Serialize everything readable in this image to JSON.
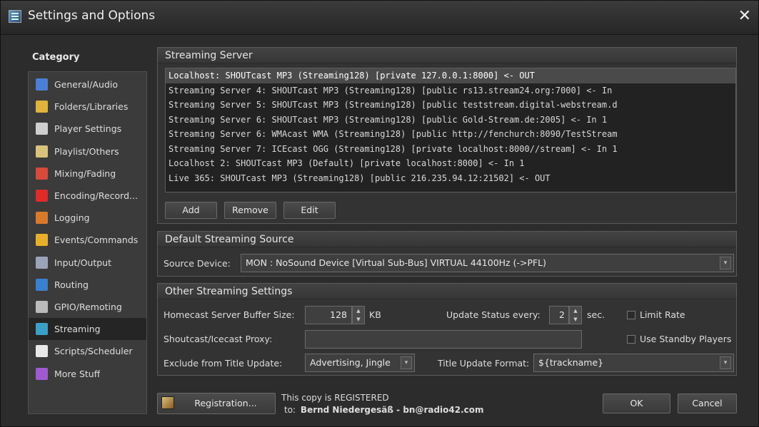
{
  "window": {
    "title": "Settings and Options"
  },
  "sidebar": {
    "heading": "Category",
    "items": [
      {
        "label": "General/Audio",
        "icon": "music-note-icon",
        "color": "#4a7fd6"
      },
      {
        "label": "Folders/Libraries",
        "icon": "folder-icon",
        "color": "#e0b43a"
      },
      {
        "label": "Player Settings",
        "icon": "player-icon",
        "color": "#cfcfcf"
      },
      {
        "label": "Playlist/Others",
        "icon": "playlist-icon",
        "color": "#d9c27a"
      },
      {
        "label": "Mixing/Fading",
        "icon": "mixing-icon",
        "color": "#d84a3a"
      },
      {
        "label": "Encoding/Record...",
        "icon": "record-icon",
        "color": "#e02a2a"
      },
      {
        "label": "Logging",
        "icon": "logging-icon",
        "color": "#d97a2a"
      },
      {
        "label": "Events/Commands",
        "icon": "lightning-icon",
        "color": "#e8b02a"
      },
      {
        "label": "Input/Output",
        "icon": "input-output-icon",
        "color": "#9aa3b8"
      },
      {
        "label": "Routing",
        "icon": "routing-icon",
        "color": "#3a7fd0"
      },
      {
        "label": "GPIO/Remoting",
        "icon": "gpio-icon",
        "color": "#bbbbbb"
      },
      {
        "label": "Streaming",
        "icon": "streaming-icon",
        "color": "#3aa0c8"
      },
      {
        "label": "Scripts/Scheduler",
        "icon": "clock-icon",
        "color": "#e8e8e8"
      },
      {
        "label": "More Stuff",
        "icon": "more-stuff-icon",
        "color": "#a05ad0"
      }
    ],
    "active_index": 11
  },
  "streaming_server": {
    "heading": "Streaming Server",
    "rows": [
      "Localhost: SHOUTcast MP3 (Streaming128) [private 127.0.0.1:8000] <- OUT",
      "Streaming Server 4: SHOUTcast MP3 (Streaming128) [public rs13.stream24.org:7000] <- In",
      "Streaming Server 5: SHOUTcast MP3 (Streaming128) [public teststream.digital-webstream.d",
      "Streaming Server 6: SHOUTcast MP3 (Streaming128) [public Gold-Stream.de:2005] <- In 1",
      "Streaming Server 6: WMAcast WMA (Streaming128) [public http://fenchurch:8090/TestStream",
      "Streaming Server 7: ICEcast OGG (Streaming128) [private localhost:8000//stream] <- In 1",
      "Localhost 2: SHOUTcast MP3 (Default) [private localhost:8000] <- In 1",
      "Live 365: SHOUTcast MP3 (Streaming128) [public 216.235.94.12:21502] <- OUT"
    ],
    "selected_index": 0,
    "add_label": "Add",
    "remove_label": "Remove",
    "edit_label": "Edit"
  },
  "default_source": {
    "heading": "Default Streaming Source",
    "source_label": "Source Device:",
    "source_value": "MON  : NoSound Device [Virtual Sub-Bus] VIRTUAL 44100Hz (->PFL)"
  },
  "other_settings": {
    "heading": "Other Streaming Settings",
    "buffer_label": "Homecast Server Buffer Size:",
    "buffer_value": "128",
    "buffer_unit": "KB",
    "update_label": "Update Status every:",
    "update_value": "2",
    "update_unit": "sec.",
    "limit_rate_label": "Limit Rate",
    "limit_rate_checked": false,
    "proxy_label": "Shoutcast/Icecast Proxy:",
    "proxy_value": "",
    "standby_label": "Use Standby Players",
    "standby_checked": false,
    "exclude_label": "Exclude from Title Update:",
    "exclude_value": "Advertising, Jingle",
    "format_label": "Title Update Format:",
    "format_value": "${trackname}"
  },
  "footer": {
    "registration_label": "Registration...",
    "reg_line1": "This copy is REGISTERED",
    "reg_to": "to:",
    "reg_name": "Bernd Niedergesäß - bn@radio42.com",
    "ok_label": "OK",
    "cancel_label": "Cancel"
  }
}
